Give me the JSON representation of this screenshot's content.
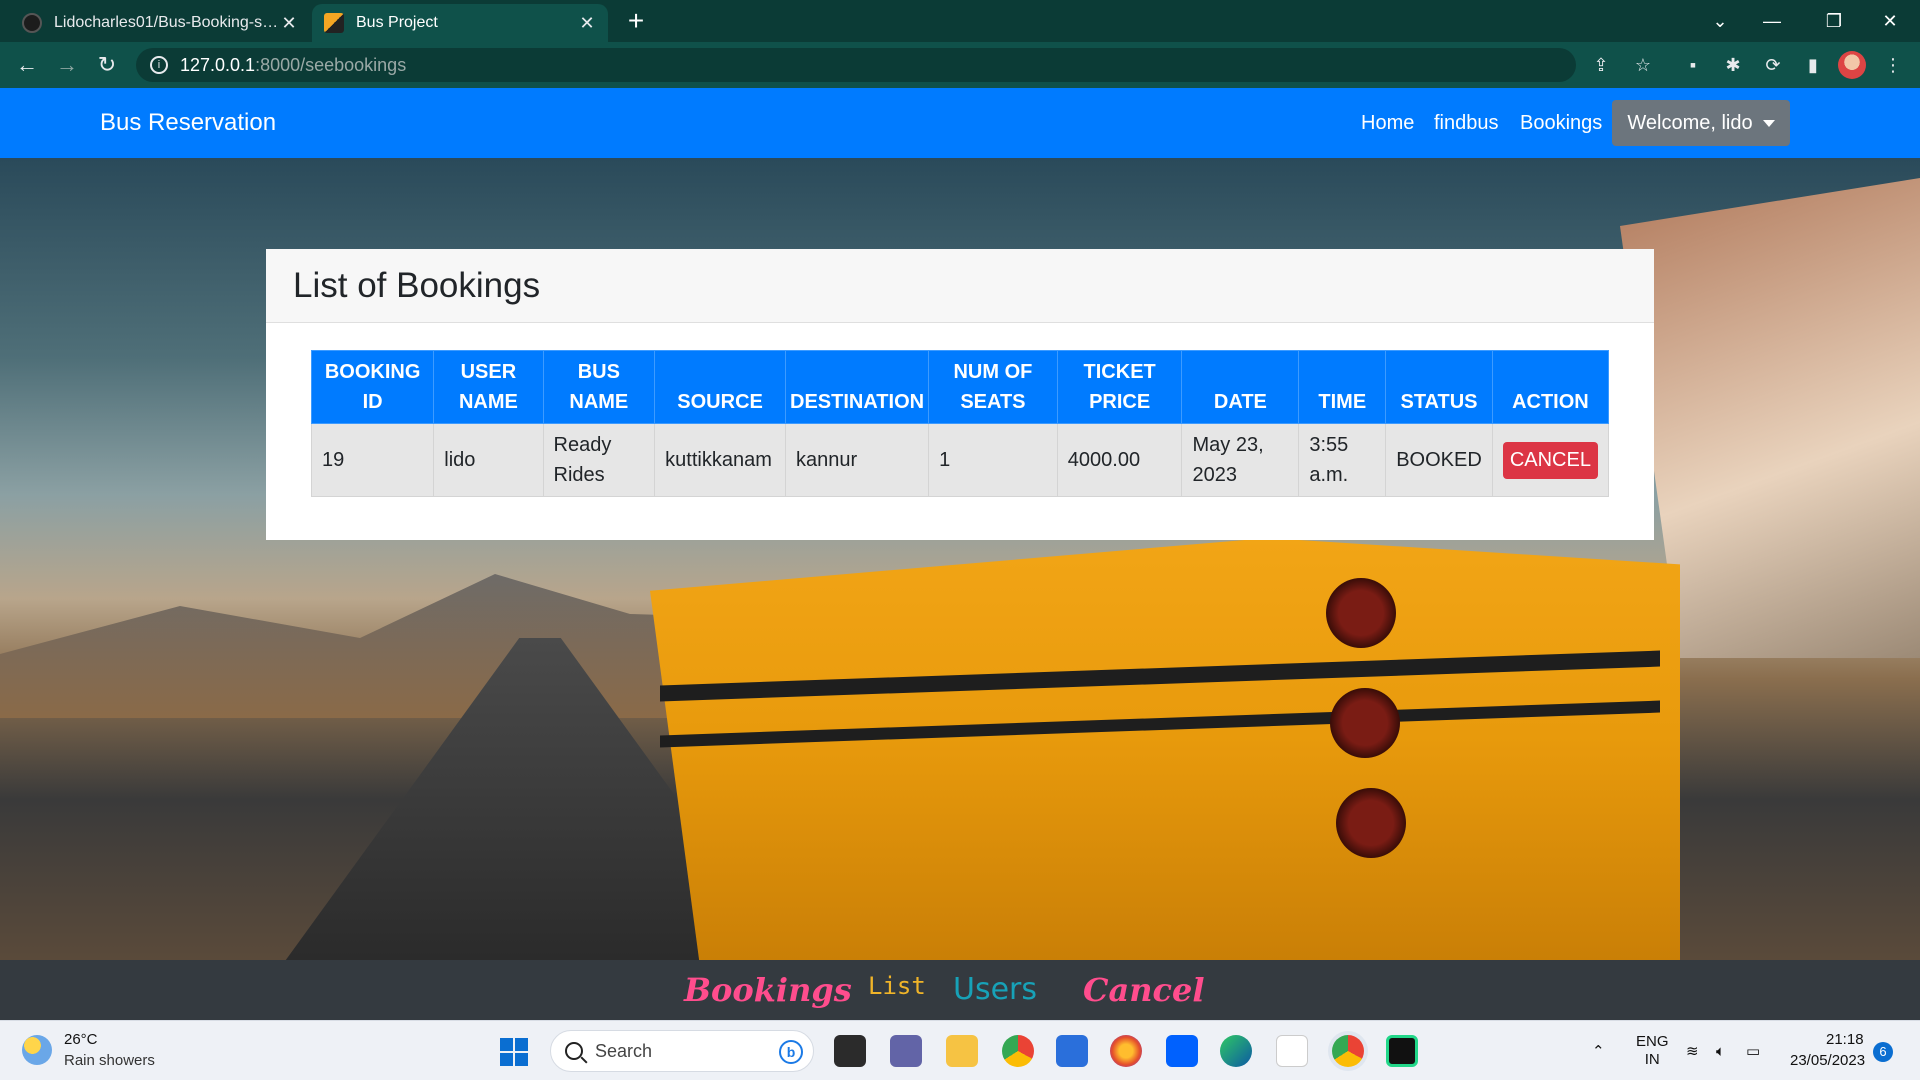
{
  "browser": {
    "tabs": [
      {
        "title": "Lidocharles01/Bus-Booking-syste",
        "active": false
      },
      {
        "title": "Bus Project",
        "active": true
      }
    ],
    "url_host": "127.0.0.1",
    "url_path": ":8000/seebookings"
  },
  "navbar": {
    "brand": "Bus Reservation",
    "links": [
      "Home",
      "findbus",
      "Bookings"
    ],
    "welcome": "Welcome, lido"
  },
  "card": {
    "title": "List of Bookings"
  },
  "table": {
    "headers": [
      "BOOKING ID",
      "USER NAME",
      "BUS NAME",
      "SOURCE",
      "DESTINATION",
      "NUM OF SEATS",
      "TICKET PRICE",
      "DATE",
      "TIME",
      "STATUS",
      "ACTION"
    ],
    "rows": [
      {
        "booking_id": "19",
        "user_name": "lido",
        "bus_name": "Ready Rides",
        "source": "kuttikkanam",
        "destination": "kannur",
        "num_seats": "1",
        "price": "4000.00",
        "date": "May 23, 2023",
        "time": "3:55 a.m.",
        "status": "BOOKED",
        "action": "CANCEL"
      }
    ]
  },
  "footer": {
    "links": [
      "Bookings",
      "List",
      "Users",
      "Cancel"
    ]
  },
  "taskbar": {
    "weather_temp": "26°C",
    "weather_desc": "Rain showers",
    "search_placeholder": "Search",
    "lang_top": "ENG",
    "lang_bottom": "IN",
    "time": "21:18",
    "date": "23/05/2023",
    "notifications": "6"
  },
  "colors": {
    "primary": "#007bff",
    "danger": "#dc3545",
    "secondary": "#6c757d",
    "footer_bg": "#343a40",
    "chrome_bg": "#0b3b36"
  }
}
